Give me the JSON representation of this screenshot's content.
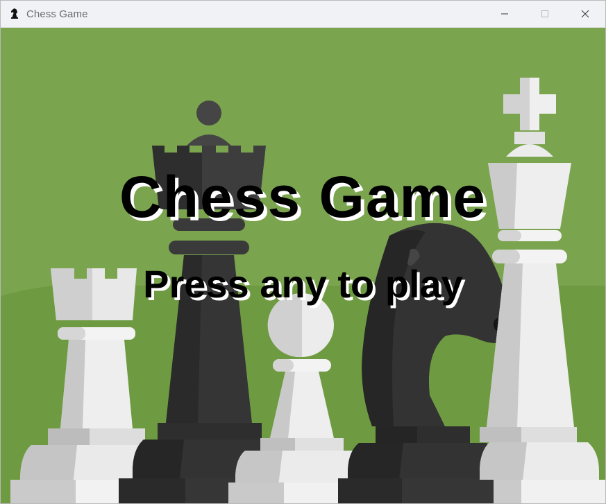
{
  "window": {
    "title": "Chess Game",
    "app_icon": "chess-knight-icon",
    "controls": [
      "minimize-icon",
      "maximize-icon",
      "close-icon"
    ]
  },
  "scene": {
    "background_color": "#7ba44f",
    "hill_color": "#6b9a3f",
    "heading": "Chess Game",
    "prompt": "Press any to play",
    "pieces": [
      "white rook",
      "black queen",
      "white pawn",
      "black knight",
      "white king"
    ]
  }
}
